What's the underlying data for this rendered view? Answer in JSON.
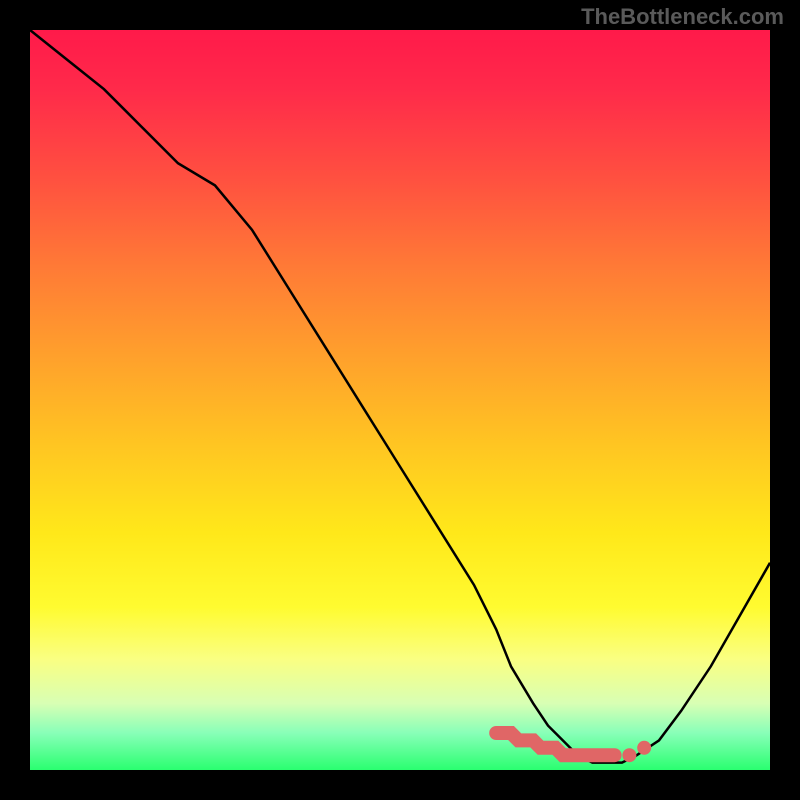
{
  "watermark": "TheBottleneck.com",
  "chart_data": {
    "type": "line",
    "title": "",
    "xlabel": "",
    "ylabel": "",
    "xlim": [
      0,
      100
    ],
    "ylim": [
      0,
      100
    ],
    "series": [
      {
        "name": "bottleneck-curve",
        "x": [
          0,
          5,
          10,
          15,
          20,
          25,
          30,
          35,
          40,
          45,
          50,
          55,
          60,
          63,
          65,
          68,
          70,
          72,
          74,
          76,
          78,
          80,
          82,
          85,
          88,
          92,
          96,
          100
        ],
        "y": [
          100,
          96,
          92,
          87,
          82,
          79,
          73,
          65,
          57,
          49,
          41,
          33,
          25,
          19,
          14,
          9,
          6,
          4,
          2,
          1,
          1,
          1,
          2,
          4,
          8,
          14,
          21,
          28
        ]
      }
    ],
    "markers": [
      {
        "name": "highlight-segment",
        "x": [
          63,
          64,
          65,
          66,
          67,
          68,
          69,
          70,
          71,
          72,
          73,
          74,
          75,
          76,
          77,
          78,
          79
        ],
        "y": [
          5,
          5,
          5,
          4,
          4,
          4,
          3,
          3,
          3,
          2,
          2,
          2,
          2,
          2,
          2,
          2,
          2
        ]
      },
      {
        "name": "dot-1",
        "x": 81,
        "y": 2
      },
      {
        "name": "dot-2",
        "x": 83,
        "y": 3
      }
    ],
    "background": {
      "type": "vertical-gradient",
      "stops": [
        {
          "pos": 0,
          "color": "#ff1a4a"
        },
        {
          "pos": 50,
          "color": "#ffc522"
        },
        {
          "pos": 80,
          "color": "#faff80"
        },
        {
          "pos": 100,
          "color": "#2aff70"
        }
      ]
    }
  }
}
